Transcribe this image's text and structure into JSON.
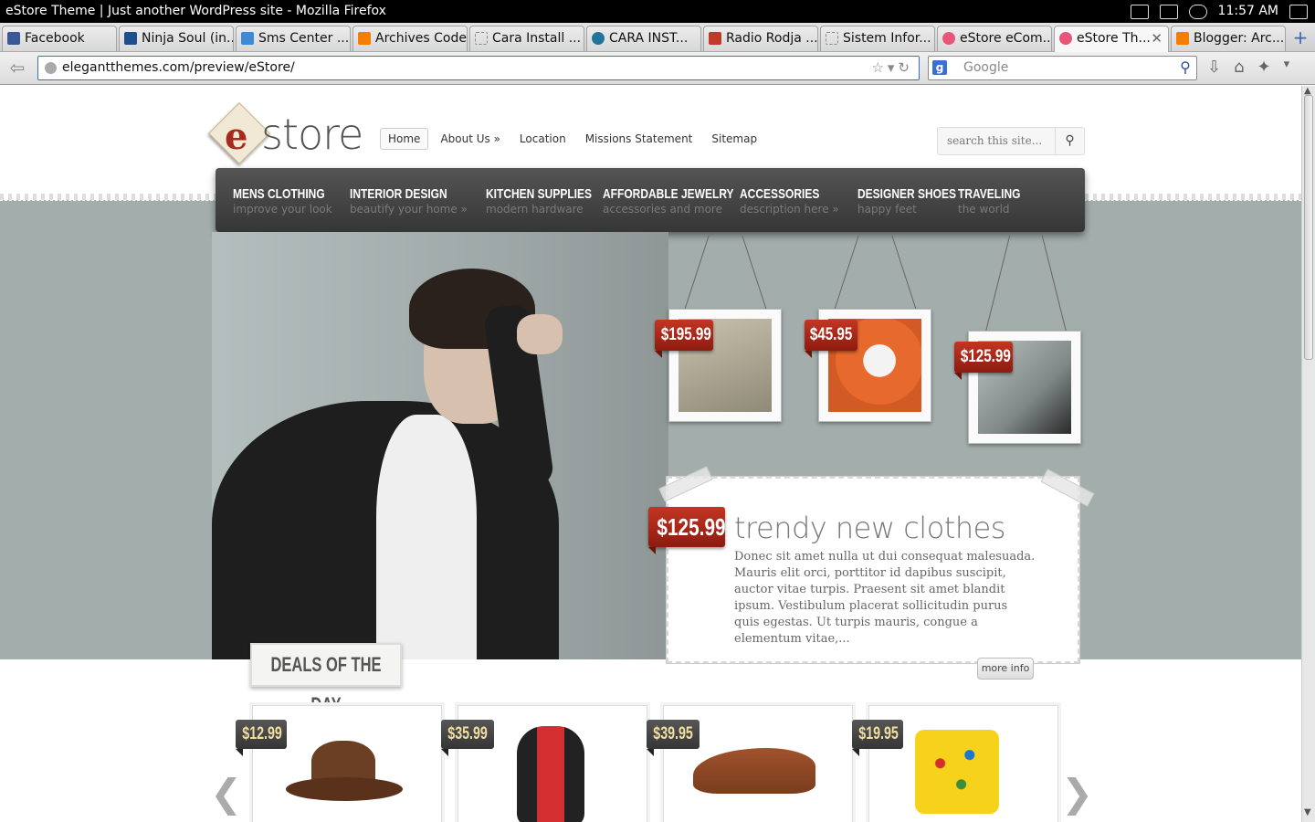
{
  "window": {
    "title": "eStore Theme | Just another WordPress site - Mozilla Firefox",
    "clock": "11:57 AM"
  },
  "tabs": [
    {
      "label": "Facebook",
      "color": "#3b5998"
    },
    {
      "label": "Ninja Soul (in...",
      "color": "#1f4e8c"
    },
    {
      "label": "Sms Center ...",
      "color": "#3d8bd6"
    },
    {
      "label": "Archives Code",
      "color": "#f57d00"
    },
    {
      "label": "Cara Install ...",
      "color": "#cccccc"
    },
    {
      "label": "CARA INST...",
      "color": "#21759b"
    },
    {
      "label": "Radio Rodja ...",
      "color": "#c0392b"
    },
    {
      "label": "Sistem Infor...",
      "color": "#cccccc"
    },
    {
      "label": "eStore eCom...",
      "color": "#e8557a"
    },
    {
      "label": "eStore Th...",
      "color": "#e8557a",
      "active": true
    },
    {
      "label": "Blogger: Arc...",
      "color": "#f57d00"
    }
  ],
  "nav": {
    "url": "elegantthemes.com/preview/eStore/",
    "search_placeholder": "Google"
  },
  "site": {
    "logo_text": "store",
    "top_nav": [
      "Home",
      "About Us »",
      "Location",
      "Missions Statement",
      "Sitemap"
    ],
    "search_placeholder": "search this site...",
    "categories": [
      {
        "title": "MENS CLOTHING",
        "sub": "improve your look"
      },
      {
        "title": "INTERIOR DESIGN",
        "sub": "beautify your home »"
      },
      {
        "title": "KITCHEN SUPPLIES",
        "sub": "modern hardware"
      },
      {
        "title": "AFFORDABLE JEWELRY",
        "sub": "accessories and more"
      },
      {
        "title": "ACCESSORIES",
        "sub": "description here »"
      },
      {
        "title": "DESIGNER SHOES",
        "sub": "happy feet"
      },
      {
        "title": "TRAVELING",
        "sub": "the world"
      }
    ],
    "hanging_products": [
      {
        "price": "$195.99",
        "color": "#b9b09a"
      },
      {
        "price": "$45.95",
        "color": "#e8692e"
      },
      {
        "price": "$125.99",
        "color": "#a8b2b1"
      }
    ],
    "featured": {
      "price": "$125.99",
      "title": "trendy new clothes",
      "body": "Donec sit amet nulla ut dui consequat malesuada. Mauris elit orci, porttitor id dapibus suscipit, auctor vitae turpis. Praesent sit amet blandit ipsum. Vestibulum placerat sollicitudin purus quis egestas. Ut turpis mauris, congue a elementum vitae,...",
      "more_label": "more info"
    },
    "deals_label": "DEALS OF THE DAY",
    "deals": [
      {
        "price": "$12.99",
        "item": "hat"
      },
      {
        "price": "$35.99",
        "item": "backpack"
      },
      {
        "price": "$39.95",
        "item": "shoe"
      },
      {
        "price": "$19.95",
        "item": "pillow"
      }
    ],
    "prev_arrow": "❮",
    "next_arrow": "❯"
  }
}
